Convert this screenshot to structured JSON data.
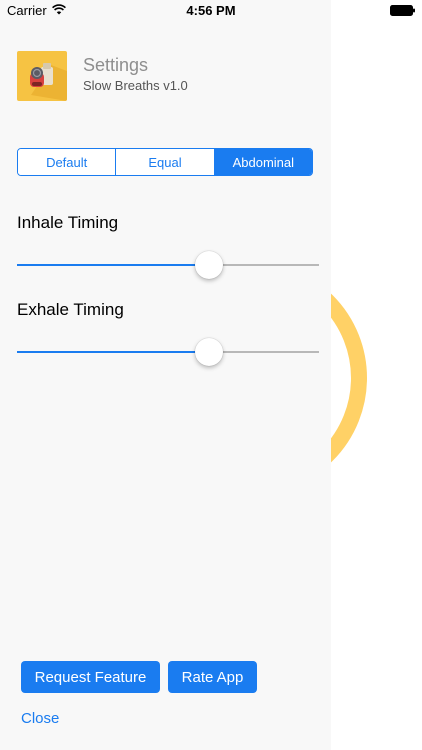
{
  "status_bar": {
    "carrier": "Carrier",
    "time": "4:56 PM"
  },
  "header": {
    "title": "Settings",
    "subtitle": "Slow Breaths v1.0",
    "icon": "app-icon"
  },
  "segmented_control": {
    "options": [
      "Default",
      "Equal",
      "Abdominal"
    ],
    "selected": "Abdominal"
  },
  "sliders": [
    {
      "label": "Inhale Timing",
      "value": 0.65
    },
    {
      "label": "Exhale Timing",
      "value": 0.65
    }
  ],
  "buttons": {
    "request_feature": "Request Feature",
    "rate_app": "Rate App",
    "close": "Close"
  },
  "colors": {
    "accent": "#1a7cf0",
    "drawer_bg": "#f8f8f8",
    "arc": "#ffd166",
    "icon_bg": "#f6c343"
  }
}
